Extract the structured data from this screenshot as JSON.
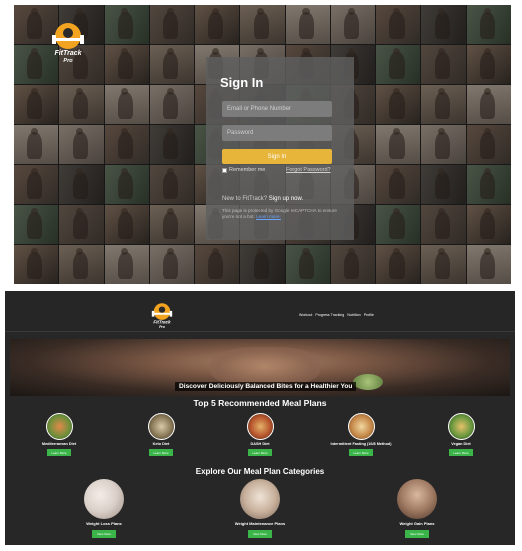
{
  "signin": {
    "logo_text": "FitTrack Pro",
    "title": "Sign In",
    "email_placeholder": "Email or Phone Number",
    "password_placeholder": "Password",
    "signin_button": "Sign In",
    "remember_label": "Remember me",
    "forgot_link": "Forgot Password?",
    "new_text": "New to FitTrack? ",
    "signup_link": "Sign up now.",
    "captcha_text": "This page is protected by Google reCAPTCHA to ensure you're not a bot. ",
    "captcha_link": "Learn more."
  },
  "meal_page": {
    "logo_text": "FitTrack Pro",
    "nav": [
      "Workout",
      "Progress Tracking",
      "Nutrition",
      "Profile"
    ],
    "hero_caption": "Discover Deliciously Balanced Bites for a Healthier You",
    "plans_title": "Top 5 Recommended Meal Plans",
    "plans": [
      {
        "name": "Mediterranean Diet",
        "button": "Learn More",
        "color": "#c9643a"
      },
      {
        "name": "Keto Diet",
        "button": "Learn More",
        "color": "#8a7a58"
      },
      {
        "name": "DASH Diet",
        "button": "Learn More",
        "color": "#b8552d"
      },
      {
        "name": "Intermittent Fasting (16/8 Method)",
        "button": "Learn More",
        "color": "#c78a4a"
      },
      {
        "name": "Vegan Diet",
        "button": "Learn More",
        "color": "#6c9a3f"
      }
    ],
    "categories_title": "Explore Our Meal Plan Categories",
    "categories": [
      {
        "name": "Weight Loss Plans",
        "button": "View More",
        "color": "#d9cfc8"
      },
      {
        "name": "Weight Maintenance Plans",
        "button": "View More",
        "color": "#c9b29e"
      },
      {
        "name": "Weight Gain Plans",
        "button": "View More",
        "color": "#a07a62"
      }
    ]
  }
}
